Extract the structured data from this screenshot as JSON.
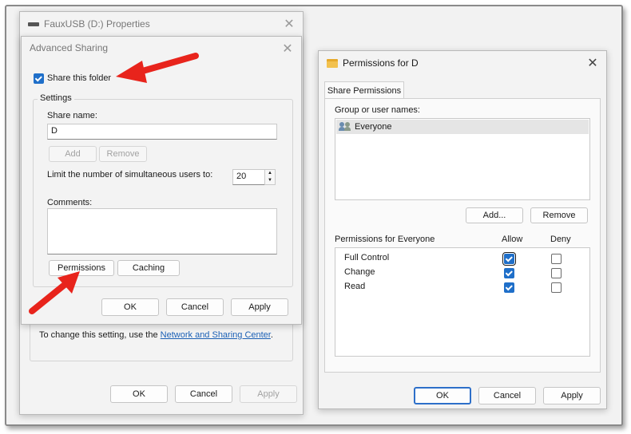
{
  "properties_window": {
    "title": "FauxUSB (D:) Properties",
    "hint_text": "To change this setting, use the",
    "hint_link": "Network and Sharing Center",
    "hint_end": ".",
    "ok_label": "OK",
    "cancel_label": "Cancel",
    "apply_label": "Apply"
  },
  "advanced_sharing": {
    "title": "Advanced Sharing",
    "share_checkbox_label": "Share this folder",
    "share_checked": true,
    "settings_group": "Settings",
    "share_name_label": "Share name:",
    "share_name_value": "D",
    "add_label": "Add",
    "remove_label": "Remove",
    "limit_label": "Limit the number of simultaneous users to:",
    "limit_value": "20",
    "comments_label": "Comments:",
    "comments_value": "",
    "permissions_label": "Permissions",
    "caching_label": "Caching",
    "ok_label": "OK",
    "cancel_label": "Cancel",
    "apply_label": "Apply"
  },
  "permissions_window": {
    "title": "Permissions for D",
    "tab_label": "Share Permissions",
    "group_label": "Group or user names:",
    "users": [
      "Everyone"
    ],
    "add_label": "Add...",
    "remove_label": "Remove",
    "perm_header": "Permissions for Everyone",
    "allow_header": "Allow",
    "deny_header": "Deny",
    "permissions": [
      {
        "name": "Full Control",
        "allow": true,
        "deny": false
      },
      {
        "name": "Change",
        "allow": true,
        "deny": false
      },
      {
        "name": "Read",
        "allow": true,
        "deny": false
      }
    ],
    "ok_label": "OK",
    "cancel_label": "Cancel",
    "apply_label": "Apply"
  },
  "annotations": {
    "arrow_color": "#e8241c"
  }
}
